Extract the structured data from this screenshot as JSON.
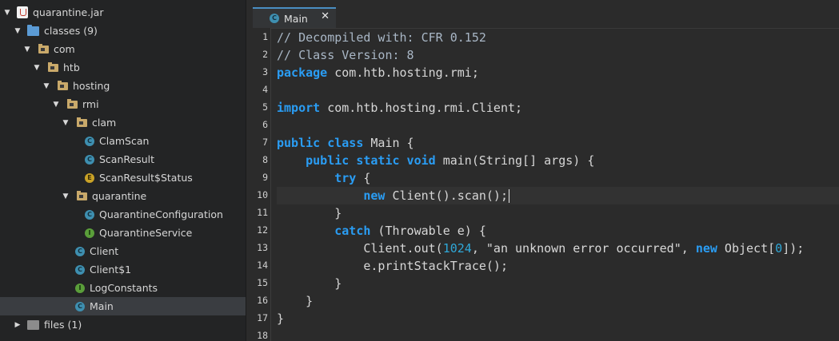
{
  "tree": {
    "root": "quarantine.jar",
    "classes": "classes (9)",
    "com": "com",
    "htb": "htb",
    "hosting": "hosting",
    "rmi": "rmi",
    "clam": "clam",
    "ClamScan": "ClamScan",
    "ScanResult": "ScanResult",
    "ScanResultStatus": "ScanResult$Status",
    "quarantine": "quarantine",
    "QuarantineConfiguration": "QuarantineConfiguration",
    "QuarantineService": "QuarantineService",
    "Client": "Client",
    "Client1": "Client$1",
    "LogConstants": "LogConstants",
    "Main": "Main",
    "files": "files (1)"
  },
  "tab": {
    "label": "Main",
    "close": "✕"
  },
  "code": {
    "line_numbers": [
      "1",
      "2",
      "3",
      "4",
      "5",
      "6",
      "7",
      "8",
      "9",
      "10",
      "11",
      "12",
      "13",
      "14",
      "15",
      "16",
      "17",
      "18"
    ],
    "l1": "// Decompiled with: CFR 0.152",
    "l2": "// Class Version: 8",
    "l3_kw": "package",
    "l3_rest": " com.htb.hosting.rmi;",
    "l5_kw": "import",
    "l5_rest": " com.htb.hosting.rmi.Client;",
    "l7_kw": "public class",
    "l7_rest": " Main {",
    "l8_kw": "public static void",
    "l8_rest": " main(String[] args) {",
    "l9_kw": "try",
    "l9_rest": " {",
    "l10_kw": "new",
    "l10_rest": " Client().scan();",
    "l11": "}",
    "l12_kw": "catch",
    "l12_rest": " (Throwable e) {",
    "l13_a": "Client.out(",
    "l13_num": "1024",
    "l13_b": ", ",
    "l13_str": "\"an unknown error occurred\"",
    "l13_c": ", ",
    "l13_kw": "new",
    "l13_d": " Object[",
    "l13_num2": "0",
    "l13_e": "]);",
    "l14": "e.printStackTrace();",
    "l15": "}",
    "l16": "}",
    "l17": "}"
  }
}
